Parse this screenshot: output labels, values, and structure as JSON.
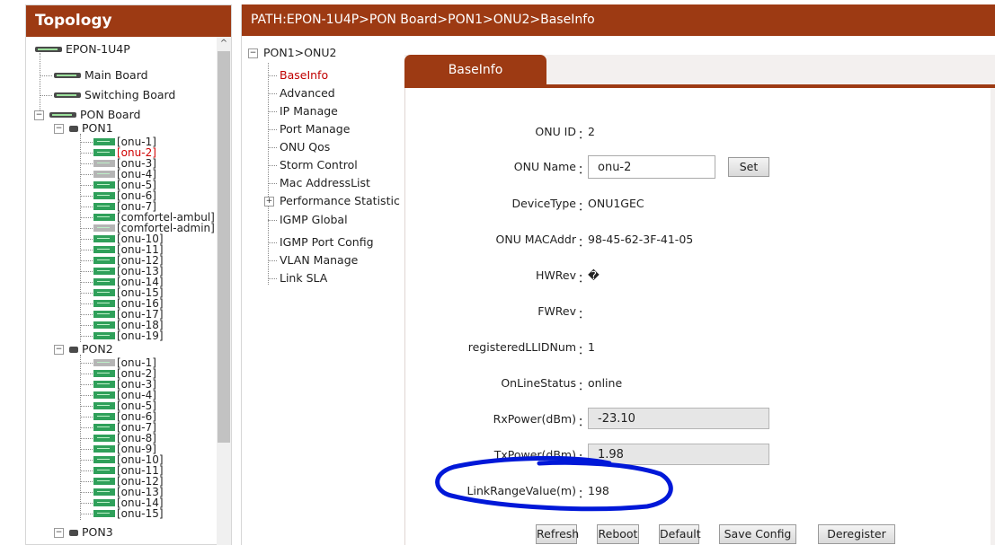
{
  "topology": {
    "title": "Topology",
    "root": "EPON-1U4P",
    "boards": [
      "Main Board",
      "Switching Board",
      "PON Board"
    ],
    "pons": [
      {
        "label": "PON1",
        "onus": [
          "[onu-1]",
          "[onu-2]",
          "[onu-3]",
          "[onu-4]",
          "[onu-5]",
          "[onu-6]",
          "[onu-7]",
          "[comfortel-ambul]",
          "[comfortel-admin]",
          "[onu-10]",
          "[onu-11]",
          "[onu-12]",
          "[onu-13]",
          "[onu-14]",
          "[onu-15]",
          "[onu-16]",
          "[onu-17]",
          "[onu-18]",
          "[onu-19]"
        ],
        "offline": [
          2,
          3,
          8
        ],
        "selected": 1
      },
      {
        "label": "PON2",
        "onus": [
          "[onu-1]",
          "[onu-2]",
          "[onu-3]",
          "[onu-4]",
          "[onu-5]",
          "[onu-6]",
          "[onu-7]",
          "[onu-8]",
          "[onu-9]",
          "[onu-10]",
          "[onu-11]",
          "[onu-12]",
          "[onu-13]",
          "[onu-14]",
          "[onu-15]"
        ],
        "offline": [
          0
        ],
        "selected": -1
      },
      {
        "label": "PON3",
        "onus": [],
        "offline": [],
        "selected": -1
      }
    ],
    "colors": {
      "online": "#2fa05a",
      "offline": "#b5b5b5",
      "selected_text": "#d00000"
    }
  },
  "path": "PATH:EPON-1U4P>PON Board>PON1>ONU2>BaseInfo",
  "menu": {
    "root": "PON1>ONU2",
    "items": [
      "BaseInfo",
      "Advanced",
      "IP Manage",
      "Port Manage",
      "ONU Qos",
      "Storm Control",
      "Mac AddressList",
      "Performance Statistic",
      "IGMP Global",
      "IGMP Port Config",
      "VLAN Manage",
      "Link SLA"
    ],
    "active": "BaseInfo"
  },
  "tab": {
    "label": "BaseInfo"
  },
  "form": {
    "onu_id": {
      "label": "ONU ID",
      "value": "2"
    },
    "onu_name": {
      "label": "ONU Name",
      "value": "onu-2",
      "set_label": "Set"
    },
    "device_type": {
      "label": "DeviceType",
      "value": "ONU1GEC"
    },
    "mac": {
      "label": "ONU MACAddr",
      "value": "98-45-62-3F-41-05"
    },
    "hwrev": {
      "label": "HWRev",
      "value": "�"
    },
    "fwrev": {
      "label": "FWRev",
      "value": ""
    },
    "llid": {
      "label": "registeredLLIDNum",
      "value": "1"
    },
    "status": {
      "label": "OnLineStatus",
      "value": "online"
    },
    "rx": {
      "label": "RxPower(dBm)",
      "value": "-23.10"
    },
    "tx": {
      "label": "TxPower(dBm)",
      "value": "1.98"
    },
    "link_range": {
      "label": "LinkRangeValue(m)",
      "value": "198"
    },
    "colon": "："
  },
  "buttons": {
    "refresh": "Refresh",
    "reboot": "Reboot",
    "default": "Default",
    "save": "Save Config",
    "deregister": "Deregister"
  },
  "theme": {
    "accent": "#9d3a13",
    "annotation": "#0018d8"
  }
}
